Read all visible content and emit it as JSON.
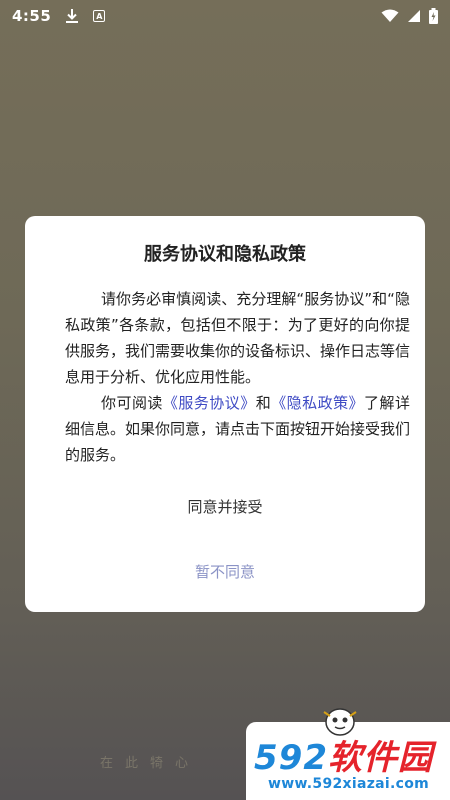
{
  "status_bar": {
    "time": "4:55",
    "download_icon": "download-icon",
    "a_badge": "A"
  },
  "dialog": {
    "title": "服务协议和隐私政策",
    "para1": "请你务必审慎阅读、充分理解“服务协议”和“隐私政策”各条款，包括但不限于：为了更好的向你提供服务，我们需要收集你的设备标识、操作日志等信息用于分析、优化应用性能。",
    "para2_prefix": "你可阅读",
    "link_service": "《服务协议》",
    "para2_and": "和",
    "link_privacy": "《隐私政策》",
    "para2_suffix": "了解详细信息。如果你同意，请点击下面按钮开始接受我们的服务。",
    "agree_label": "同意并接受",
    "disagree_label": "暂不同意",
    "link_color": "#3f4bc4",
    "disagree_color": "#8b93c6"
  },
  "background": {
    "caption": "在此犄心"
  },
  "watermark": {
    "logo_num": "592",
    "logo_text": "软件园",
    "url": "www.592xiazai.com"
  }
}
